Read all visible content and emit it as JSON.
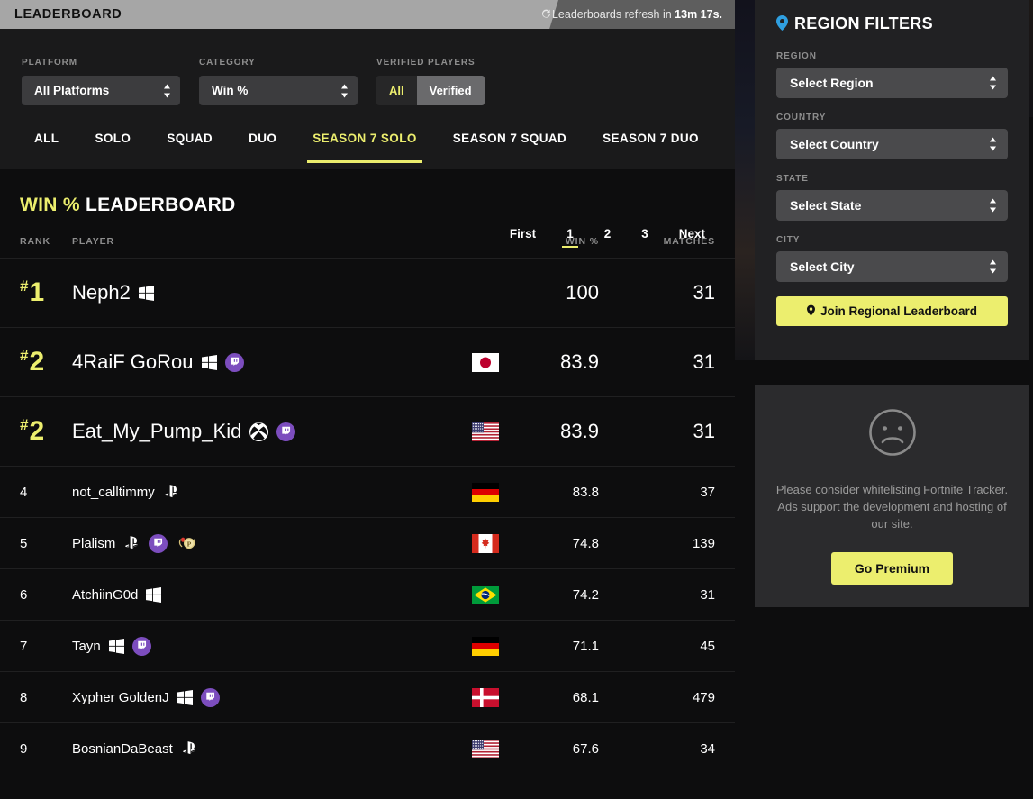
{
  "header": {
    "title": "LEADERBOARD",
    "refresh_prefix": "Leaderboards refresh in ",
    "refresh_time": "13m 17s.",
    "refresh_icon": "refresh-icon"
  },
  "filters": {
    "platform": {
      "label": "PLATFORM",
      "value": "All Platforms"
    },
    "category": {
      "label": "CATEGORY",
      "value": "Win %"
    },
    "verified": {
      "label": "VERIFIED PLAYERS",
      "all": "All",
      "verified": "Verified",
      "active": "All"
    }
  },
  "tabs": [
    {
      "label": "ALL",
      "active": false
    },
    {
      "label": "SOLO",
      "active": false
    },
    {
      "label": "SQUAD",
      "active": false
    },
    {
      "label": "DUO",
      "active": false
    },
    {
      "label": "SEASON 7 SOLO",
      "active": true
    },
    {
      "label": "SEASON 7 SQUAD",
      "active": false
    },
    {
      "label": "SEASON 7 DUO",
      "active": false
    }
  ],
  "board": {
    "title_highlight": "WIN %",
    "title_rest": "LEADERBOARD"
  },
  "pagination": {
    "first": "First",
    "pages": [
      "1",
      "2",
      "3"
    ],
    "active_page": "1",
    "next": "Next"
  },
  "table": {
    "columns": {
      "rank": "RANK",
      "player": "PLAYER",
      "win": "WIN %",
      "matches": "MATCHES"
    },
    "rows": [
      {
        "rank": "1",
        "hash": "#",
        "top": true,
        "player": "Neph2",
        "platform": "windows",
        "badges": [],
        "flag": "none",
        "win": "100",
        "matches": "31"
      },
      {
        "rank": "2",
        "hash": "#",
        "top": true,
        "player": "4RaiF GoRou",
        "platform": "windows",
        "badges": [
          "twitch"
        ],
        "flag": "jp",
        "win": "83.9",
        "matches": "31"
      },
      {
        "rank": "2",
        "hash": "#",
        "top": true,
        "player": "Eat_My_Pump_Kid",
        "platform": "xbox",
        "badges": [
          "twitch"
        ],
        "flag": "us",
        "win": "83.9",
        "matches": "31"
      },
      {
        "rank": "4",
        "hash": "",
        "top": false,
        "player": "not_calltimmy",
        "platform": "playstation",
        "badges": [],
        "flag": "de",
        "win": "83.8",
        "matches": "37"
      },
      {
        "rank": "5",
        "hash": "",
        "top": false,
        "player": "Plalism",
        "platform": "playstation",
        "badges": [
          "twitch",
          "premium"
        ],
        "flag": "ca",
        "win": "74.8",
        "matches": "139"
      },
      {
        "rank": "6",
        "hash": "",
        "top": false,
        "player": "AtchiinG0d",
        "platform": "windows",
        "badges": [],
        "flag": "br",
        "win": "74.2",
        "matches": "31"
      },
      {
        "rank": "7",
        "hash": "",
        "top": false,
        "player": "Tayn",
        "platform": "windows",
        "badges": [
          "twitch"
        ],
        "flag": "de",
        "win": "71.1",
        "matches": "45"
      },
      {
        "rank": "8",
        "hash": "",
        "top": false,
        "player": "Xypher GoldenJ",
        "platform": "windows",
        "badges": [
          "twitch"
        ],
        "flag": "dk",
        "win": "68.1",
        "matches": "479"
      },
      {
        "rank": "9",
        "hash": "",
        "top": false,
        "player": "BosnianDaBeast",
        "platform": "playstation",
        "badges": [],
        "flag": "us",
        "win": "67.6",
        "matches": "34"
      }
    ]
  },
  "sidebar": {
    "region_card": {
      "title": "REGION FILTERS",
      "pin_icon": "location-pin-icon",
      "fields": [
        {
          "label": "REGION",
          "value": "Select Region"
        },
        {
          "label": "COUNTRY",
          "value": "Select Country"
        },
        {
          "label": "STATE",
          "value": "Select State"
        },
        {
          "label": "CITY",
          "value": "Select City"
        }
      ],
      "join_button": "Join Regional Leaderboard"
    },
    "ad_card": {
      "icon": "sad-face-icon",
      "text": "Please consider whitelisting Fortnite Tracker. Ads support the development and hosting of our site.",
      "button": "Go Premium"
    }
  },
  "colors": {
    "accent": "#ecee6e",
    "panel": "#1a1a1b",
    "page_bg": "#0d0d0e",
    "pin_blue": "#2f9fe0",
    "twitch_purple": "#7c4dbe"
  }
}
